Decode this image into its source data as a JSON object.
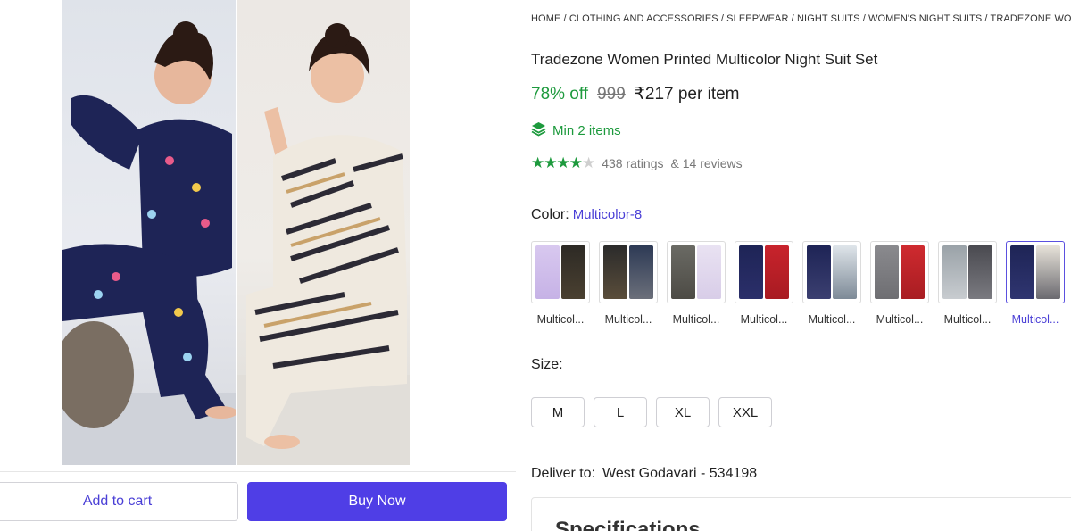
{
  "breadcrumb": "HOME / CLOTHING AND ACCESSORIES / SLEEPWEAR / NIGHT SUITS / WOMEN'S NIGHT SUITS / TRADEZONE WOMEN PRINTED MULTICOLOR NIGHT SUIT SET",
  "product": {
    "title": "Tradezone Women Printed Multicolor Night Suit Set",
    "discount": "78% off",
    "mrp": "999",
    "price": "₹217 per item",
    "min_items": "Min 2 items",
    "rating_stars": 4.5,
    "ratings_text": "438 ratings",
    "reviews_text": "& 14 reviews"
  },
  "color": {
    "label": "Color:",
    "selected": "Multicolor-8",
    "options": [
      {
        "name": "Multicol..."
      },
      {
        "name": "Multicol..."
      },
      {
        "name": "Multicol..."
      },
      {
        "name": "Multicol..."
      },
      {
        "name": "Multicol..."
      },
      {
        "name": "Multicol..."
      },
      {
        "name": "Multicol..."
      },
      {
        "name": "Multicol..."
      }
    ]
  },
  "size": {
    "label": "Size:",
    "options": [
      "M",
      "L",
      "XL",
      "XXL"
    ]
  },
  "delivery": {
    "label": "Deliver to:",
    "location": "West Godavari - 534198"
  },
  "specifications": {
    "title": "Specifications"
  },
  "actions": {
    "add_to_cart": "Add to cart",
    "buy_now": "Buy Now"
  },
  "colors": {
    "accent": "#4f3ee6",
    "discount_green": "#1d9a3d"
  }
}
